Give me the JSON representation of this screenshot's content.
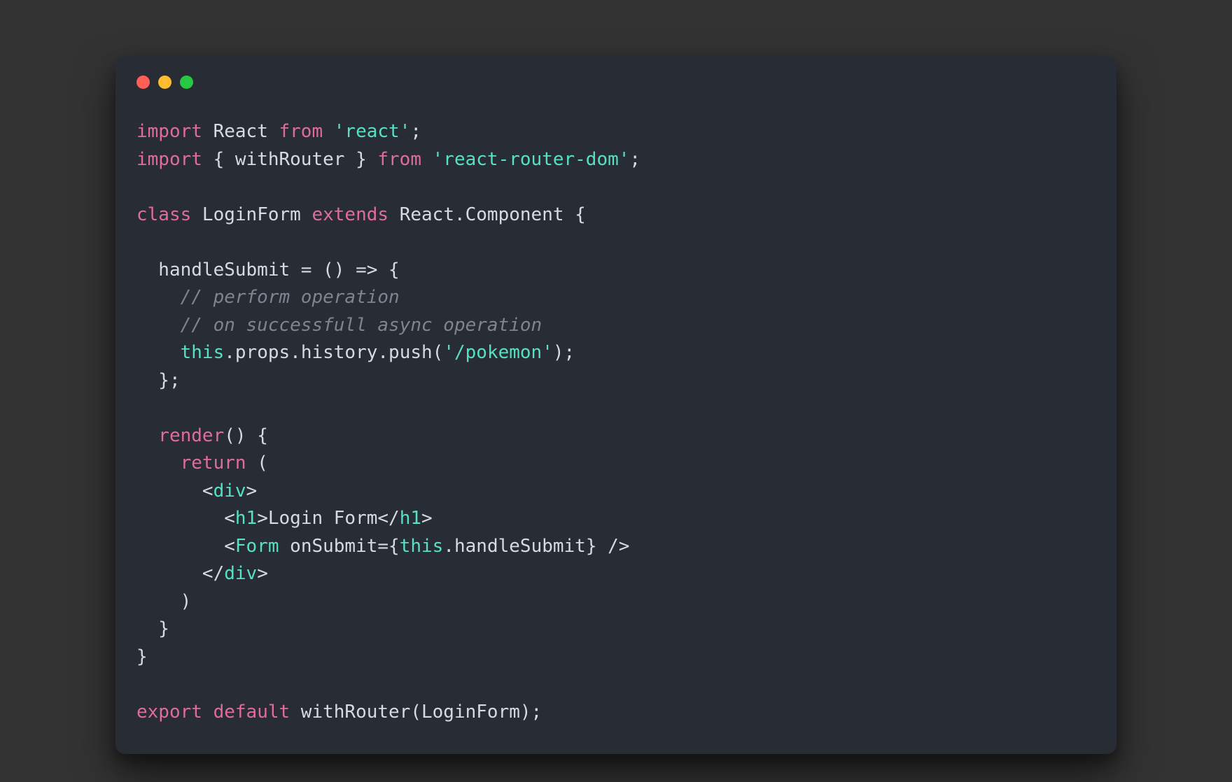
{
  "colors": {
    "bg": "#333333",
    "panel": "#282c34",
    "red": "#ff5f57",
    "yellow": "#febc2e",
    "green": "#28c840",
    "keyword": "#e06c9b",
    "string": "#56e0c4",
    "comment": "#7f848e",
    "plain": "#d7dae0"
  },
  "code": {
    "l1": {
      "import": "import",
      "react": " React ",
      "from": "from",
      "str": "'react'",
      "semi": ";"
    },
    "l2": {
      "import": "import",
      "brace": " { withRouter } ",
      "from": "from",
      "str": "'react-router-dom'",
      "semi": ";"
    },
    "l4": {
      "class": "class",
      "name": " LoginForm ",
      "extends": "extends",
      "super": " React.Component {"
    },
    "l6": {
      "sig": "  handleSubmit = () => {"
    },
    "l7": {
      "comment": "    // perform operation"
    },
    "l8": {
      "comment": "    // on successfull async operation"
    },
    "l9": {
      "indent": "    ",
      "this": "this",
      "chain": ".props.history.push(",
      "str": "'/pokemon'",
      "end": ");"
    },
    "l10": {
      "text": "  };"
    },
    "l12": {
      "render": "  render",
      "rest": "() {"
    },
    "l13": {
      "indent": "    ",
      "return": "return",
      "paren": " ("
    },
    "l14": {
      "indent": "      ",
      "open": "<",
      "tag": "div",
      "close": ">"
    },
    "l15": {
      "indent": "        ",
      "open": "<",
      "tag": "h1",
      "close": ">",
      "text": "Login Form",
      "open2": "</",
      "tag2": "h1",
      "close2": ">"
    },
    "l16": {
      "indent": "        ",
      "open": "<",
      "tag": "Form",
      "attr": " onSubmit",
      "eq": "={",
      "this": "this",
      "handle": ".handleSubmit} ",
      "selfclose": "/>"
    },
    "l17": {
      "indent": "      ",
      "open": "</",
      "tag": "div",
      "close": ">"
    },
    "l18": {
      "text": "    )"
    },
    "l19": {
      "text": "  }"
    },
    "l20": {
      "text": "}"
    },
    "l22": {
      "export": "export",
      "default": " default",
      "call": " withRouter(LoginForm);"
    }
  }
}
